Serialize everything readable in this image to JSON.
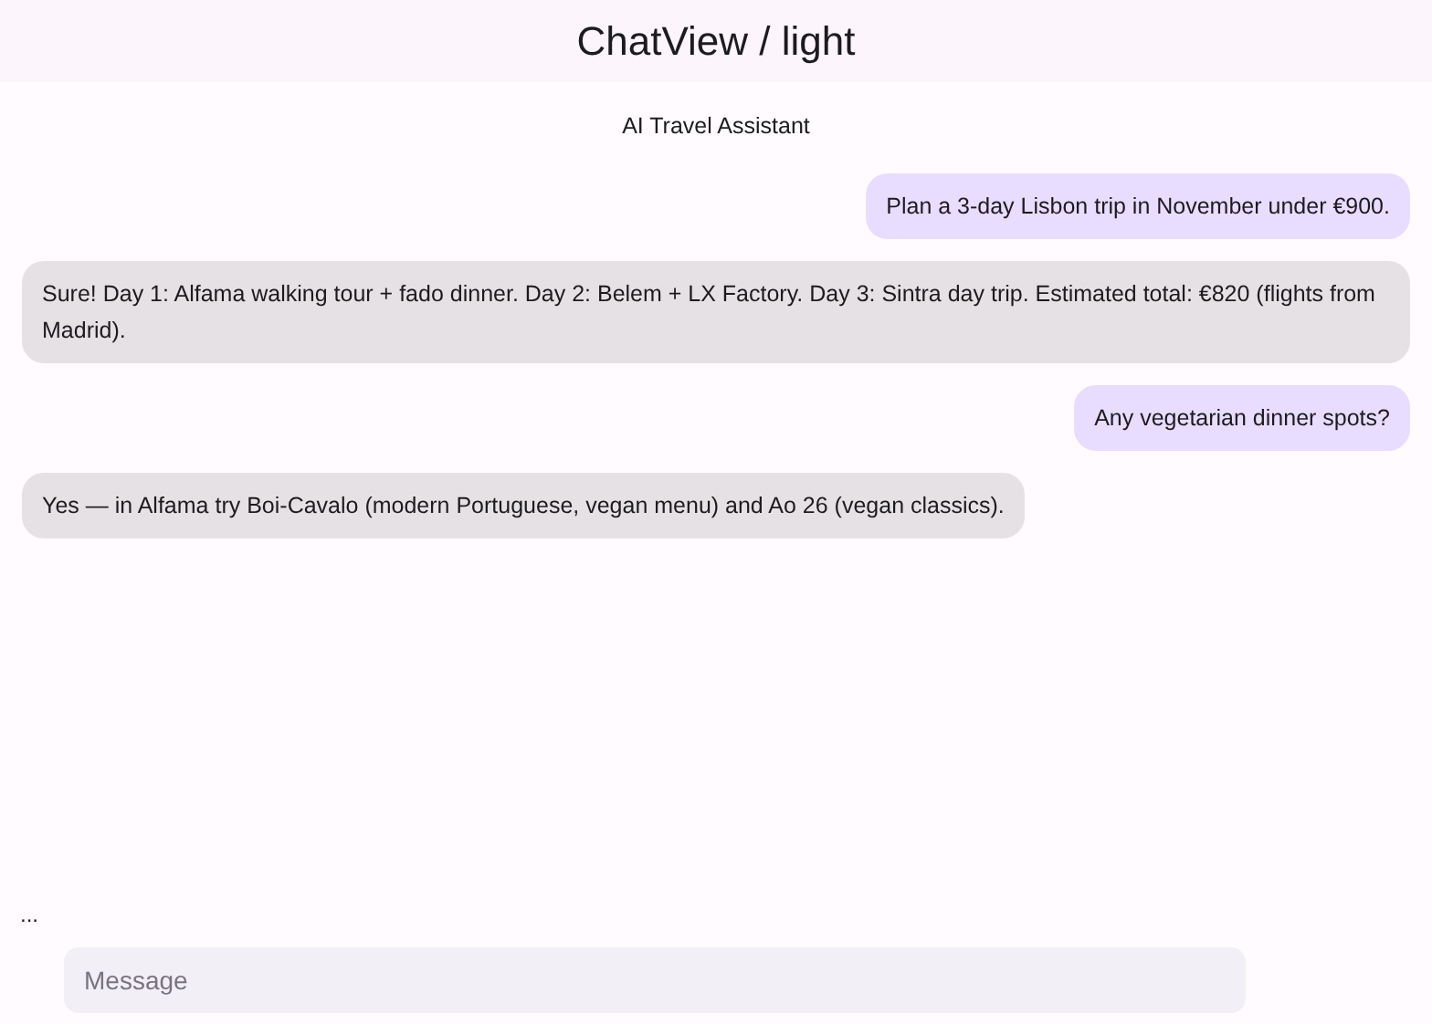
{
  "header": {
    "title": "ChatView / light"
  },
  "chat": {
    "title": "AI Travel Assistant",
    "messages": [
      {
        "kind": "user",
        "text": "Plan a 3-day Lisbon trip in November under €900."
      },
      {
        "kind": "assistant",
        "text": "Sure! Day 1: Alfama walking tour + fado dinner. Day 2: Belem + LX Factory. Day 3: Sintra day trip. Estimated total: €820 (flights from Madrid)."
      },
      {
        "kind": "user",
        "text": "Any vegetarian dinner spots?"
      },
      {
        "kind": "assistant",
        "text": "Yes — in Alfama try Boi-Cavalo (modern Portuguese, vegan menu) and Ao 26 (vegan classics)."
      }
    ],
    "typing_indicator": "...",
    "composer": {
      "placeholder": "Message"
    }
  }
}
